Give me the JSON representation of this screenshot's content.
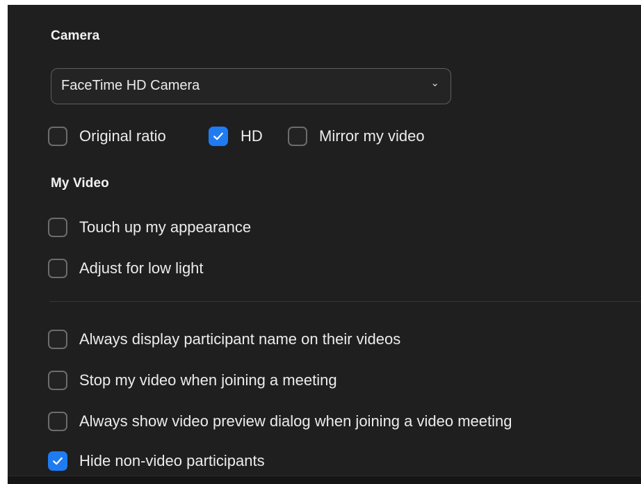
{
  "sections": {
    "camera_title": "Camera",
    "my_video_title": "My Video"
  },
  "camera": {
    "selected": "FaceTime HD Camera",
    "caret_icon": "chevron-down-icon",
    "options": [
      {
        "label": "Original ratio",
        "checked": false
      },
      {
        "label": "HD",
        "checked": true
      },
      {
        "label": "Mirror my video",
        "checked": false
      }
    ]
  },
  "my_video": {
    "options": [
      {
        "label": "Touch up my appearance",
        "checked": false
      },
      {
        "label": "Adjust for low light",
        "checked": false
      }
    ]
  },
  "general": {
    "options": [
      {
        "label": "Always display participant name on their videos",
        "checked": false
      },
      {
        "label": "Stop my video when joining a meeting",
        "checked": false
      },
      {
        "label": "Always show video preview dialog when joining a video meeting",
        "checked": false
      },
      {
        "label": "Hide non-video participants",
        "checked": true
      }
    ]
  },
  "colors": {
    "accent": "#1f7bf2",
    "panel_background": "#1f1f1f",
    "text": "#ececec"
  }
}
